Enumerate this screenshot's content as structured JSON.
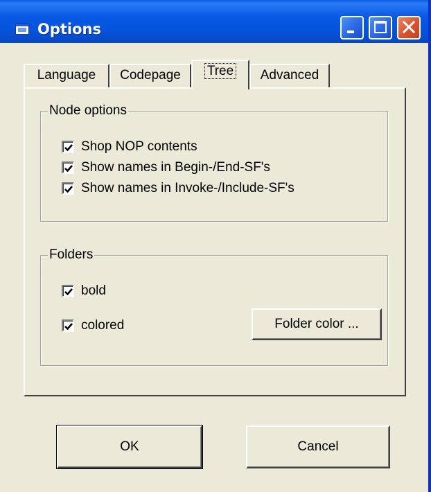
{
  "window": {
    "title": "Options"
  },
  "tabs": [
    {
      "label": "Language",
      "active": false
    },
    {
      "label": "Codepage",
      "active": false
    },
    {
      "label": "Tree",
      "active": true
    },
    {
      "label": "Advanced",
      "active": false
    }
  ],
  "node_options": {
    "legend": "Node options",
    "items": [
      {
        "label": "Shop NOP contents",
        "checked": true
      },
      {
        "label": "Show names in Begin-/End-SF's",
        "checked": true
      },
      {
        "label": "Show names in Invoke-/Include-SF's",
        "checked": true
      }
    ]
  },
  "folders": {
    "legend": "Folders",
    "items": [
      {
        "label": "bold",
        "checked": true
      },
      {
        "label": "colored",
        "checked": true
      }
    ],
    "color_button_label": "Folder color ..."
  },
  "footer": {
    "ok_label": "OK",
    "cancel_label": "Cancel"
  },
  "colors": {
    "titlebar_blue": "#0758E4",
    "dialog_face": "#ECE9D8",
    "close_red": "#D9522E"
  }
}
